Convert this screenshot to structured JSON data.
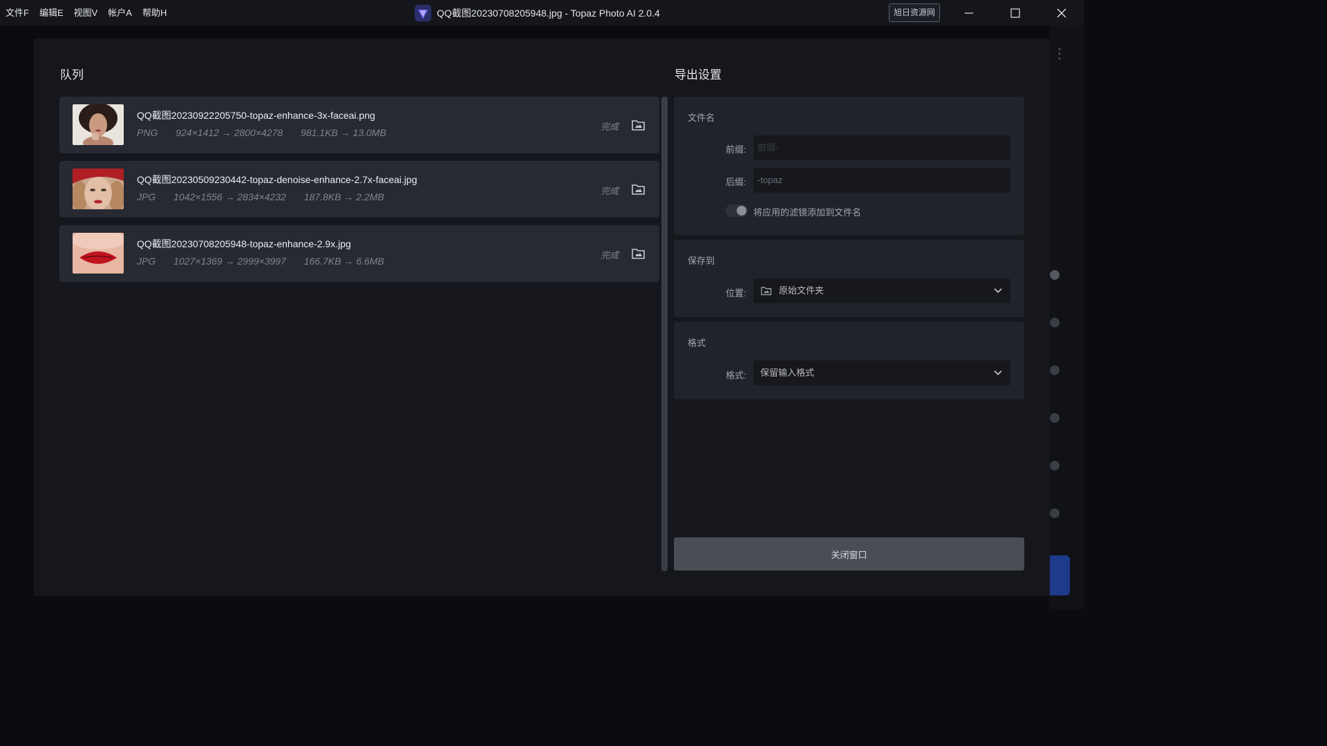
{
  "menu": [
    "文件F",
    "编辑E",
    "视图V",
    "帐户A",
    "帮助H"
  ],
  "window_title": "QQ截图20230708205948.jpg - Topaz Photo AI 2.0.4",
  "watermark": "旭日资源网",
  "queue": {
    "title": "队列",
    "items": [
      {
        "name": "QQ截图20230922205750-topaz-enhance-3x-faceai.png",
        "format": "PNG",
        "dimensions": "924×1412 → 2800×4278",
        "size": "981.1KB → 13.0MB",
        "status": "完成"
      },
      {
        "name": "QQ截图20230509230442-topaz-denoise-enhance-2.7x-faceai.jpg",
        "format": "JPG",
        "dimensions": "1042×1556 → 2834×4232",
        "size": "187.8KB → 2.2MB",
        "status": "完成"
      },
      {
        "name": "QQ截图20230708205948-topaz-enhance-2.9x.jpg",
        "format": "JPG",
        "dimensions": "1027×1369 → 2999×3997",
        "size": "166.7KB → 6.6MB",
        "status": "完成"
      }
    ]
  },
  "export": {
    "title": "导出设置",
    "filename": {
      "label": "文件名",
      "prefix_label": "前缀:",
      "prefix_placeholder": "前缀-",
      "suffix_label": "后缀:",
      "suffix_value": "-topaz",
      "toggle_label": "将应用的滤镜添加到文件名"
    },
    "save_to": {
      "label": "保存到",
      "location_label": "位置:",
      "location_value": "原始文件夹"
    },
    "format": {
      "label": "格式",
      "format_label": "格式:",
      "format_value": "保留输入格式"
    },
    "close_button": "关闭窗口"
  },
  "colors": {
    "background": "#0b0c0f",
    "modal": "#16171d",
    "card": "#20232a",
    "queue_item": "#272a33",
    "accent": "#6b5cf5"
  }
}
